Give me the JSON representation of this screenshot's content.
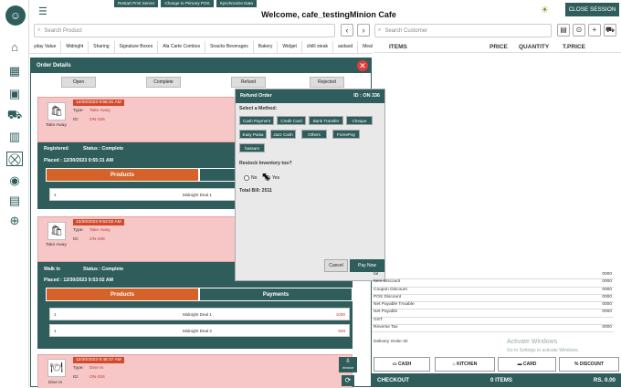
{
  "top_strip": [
    "Restart Print Server",
    "Change to Primary POS",
    "Synchronize Data"
  ],
  "welcome": "Welcome, cafe_testingMinion Cafe",
  "close_session": "CLOSE SESSION",
  "product_search_placeholder": "Search Product",
  "customer_search_placeholder": "Search Customer",
  "categories": [
    "yday Value",
    "Midnight",
    "Sharing",
    "Signature Boxes",
    "Ala Carte Combos",
    "Snacks Beverages",
    "Bakery",
    "Widget",
    "chilli steak",
    "asdasd",
    "Meal M"
  ],
  "items_header": {
    "items": "ITEMS",
    "price": "PRICE",
    "quantity": "QUANTITY",
    "tprice": "T.PRICE"
  },
  "modal": {
    "title": "Order Details",
    "filter_tabs": [
      "Open",
      "Complete",
      "Refund",
      "Rejected"
    ],
    "order1": {
      "date": "12/30/2023 9:55:31 AM",
      "type_label": "Type:",
      "type": "Take Away",
      "id_label": "ID:",
      "id": "ON-336",
      "icon_label": "Take Away",
      "status_title": "Registered",
      "status": "Status : Complete",
      "placed": "Placed : 12/30/2023 9:55:31 AM",
      "products_tab": "Products",
      "item_qty": "1",
      "item_name": "Midnight Deal 1"
    },
    "order2": {
      "date": "12/30/2023 9:53:02 AM",
      "type_label": "Type:",
      "type": "Take Away",
      "id_label": "ID:",
      "id": "ON-335",
      "icon_label": "Take Away",
      "status_title": "Walk In",
      "status": "Status : Complete",
      "placed": "Placed : 12/30/2023 9:53:02 AM",
      "products_tab": "Products",
      "payments_tab": "Payments",
      "items": [
        {
          "qty": "1",
          "name": "Midnight Deal 1",
          "price": "1000"
        },
        {
          "qty": "1",
          "name": "Midnight Deal 2",
          "price": "849"
        }
      ]
    },
    "order3": {
      "date": "12/30/2023 9:48:37 AM",
      "type_label": "Type:",
      "type": "Dine In",
      "id_label": "ID:",
      "id": "ON-334",
      "icon_label": "Dine In",
      "invoice": "Invoice"
    }
  },
  "refund": {
    "title": "Refund Order",
    "id_text": "ID :  ON 336",
    "select_method": "Select a Method:",
    "methods": [
      "Cash Payment",
      "Credit Card",
      "Bank Transfer",
      "Cheque",
      "Easy Paisa",
      "Jazz Cash",
      "Others",
      "ForeePay",
      "hassam"
    ],
    "restock_label": "Restock Inventory too?",
    "no_label": "No",
    "yes_label": "Yes",
    "total_bill": "Total Bill:  2511",
    "cancel": "Cancel",
    "pay_now": "Pay Now"
  },
  "summary": [
    {
      "label": "tal",
      "value": "0000"
    },
    {
      "label": "Item Discount",
      "value": "0000"
    },
    {
      "label": "Coupon Discount",
      "value": "0000"
    },
    {
      "label": "POS Discount",
      "value": "0000"
    },
    {
      "label": "Net Payable TAxable",
      "value": "0000"
    },
    {
      "label": "Net Payable",
      "value": "0000"
    },
    {
      "label": "GST",
      "value": ""
    },
    {
      "label": "Reverse Tax",
      "value": "0000"
    }
  ],
  "delivery_label": "Delivery  Order ID:",
  "actions": {
    "cash": "CASH",
    "kitchen": "KITCHEN",
    "card": "CARD",
    "discount": "DISCOUNT"
  },
  "checkout": {
    "label": "CHECKOUT",
    "items": "0 ITEMS",
    "total": "RS. 0.00"
  },
  "watermark": {
    "title": "Activate Windows",
    "sub": "Go to Settings to activate Windows."
  }
}
